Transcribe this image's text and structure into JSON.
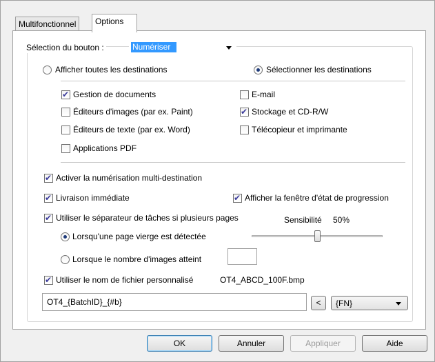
{
  "tabs": [
    {
      "label": "Multifonctionnel"
    },
    {
      "label": "Options"
    }
  ],
  "selection": {
    "label": "Sélection du bouton :",
    "value": "Numériser"
  },
  "destinations": {
    "show_all_label": "Afficher toutes les destinations",
    "select_label": "Sélectionner les destinations"
  },
  "checkboxes": {
    "document_management": "Gestion de documents",
    "image_editors": "Éditeurs d'images (par ex. Paint)",
    "text_editors": "Éditeurs de texte (par ex. Word)",
    "pdf_applications": "Applications PDF",
    "email": "E-mail",
    "storage_cdrw": "Stockage et CD-R/W",
    "fax_printer": "Télécopieur et imprimante"
  },
  "options": {
    "multi_destination": "Activer la numérisation multi-destination",
    "instant_delivery": "Livraison immédiate",
    "show_progress": "Afficher la fenêtre d'état de progression",
    "job_separator": "Utiliser le séparateur de tâches si plusieurs pages",
    "sensitivity_label": "Sensibilité",
    "sensitivity_value": "50%",
    "sensitivity_level": 0.5,
    "blank_page": "Lorsqu'une page vierge est détectée",
    "image_count": "Lorsque le nombre d'images atteint",
    "image_count_value": "",
    "custom_filename": "Utiliser le nom de fichier personnalisé",
    "filename_preview": "OT4_ABCD_100F.bmp",
    "filename_pattern": "OT4_{BatchID}_{#b}",
    "insert_button": "<",
    "token_value": "{FN}"
  },
  "buttons": {
    "ok": "OK",
    "cancel": "Annuler",
    "apply": "Appliquer",
    "help": "Aide"
  },
  "colors": {
    "selection_highlight": "#3399ff",
    "checkmark": "#3b3b9b"
  }
}
